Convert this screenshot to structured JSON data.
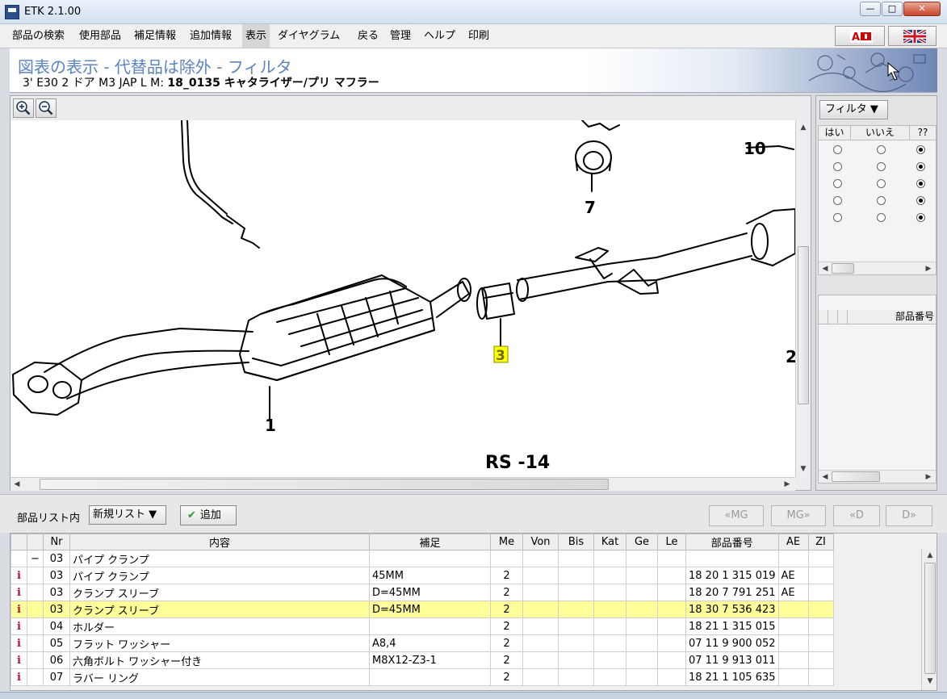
{
  "window": {
    "title": "ETK 2.1.00",
    "min": "—",
    "max": "□",
    "close": "✕"
  },
  "menu": {
    "items": [
      "部品の検索",
      "使用部品",
      "補足情報",
      "追加情報",
      "表示",
      "ダイヤグラム",
      "戻る",
      "管理",
      "ヘルプ",
      "印刷"
    ],
    "active_index": 4
  },
  "header": {
    "title": "図表の表示 - 代替品は除外 - フィルタ",
    "subtitle_model": "3' E30 2 ドア M3 JAP  L M: ",
    "subtitle_part": "18_0135 キャタライザー/プリ マフラー"
  },
  "diagram": {
    "labels": {
      "l1": "1",
      "l2": "2",
      "l3": "3",
      "l7": "7",
      "l10": "10",
      "ref": "RS -14"
    },
    "highlight_color": "#ffff00"
  },
  "filter": {
    "button": "フィルタ ▼",
    "columns": [
      "はい",
      "いいえ",
      "??"
    ],
    "rows": 5,
    "parts_header": "部品番号"
  },
  "list_toolbar": {
    "label": "部品リスト内",
    "list_select": "新規リスト ▼",
    "add": "追加",
    "nav": [
      "«MG",
      "MG»",
      "«D",
      "D»"
    ]
  },
  "table": {
    "columns": [
      "",
      "",
      "Nr",
      "内容",
      "補足",
      "Me",
      "Von",
      "Bis",
      "Kat",
      "Ge",
      "Le",
      "部品番号",
      "AE",
      "ZI"
    ],
    "rows": [
      {
        "i": "",
        "t": "−",
        "nr": "03",
        "desc": "パイプ クランプ",
        "sup": "",
        "me": "",
        "pn": "",
        "ae": "",
        "sel": false
      },
      {
        "i": "i",
        "t": "",
        "nr": "03",
        "desc": "パイプ クランプ",
        "sup": "45MM",
        "me": "2",
        "pn": "18 20 1 315 019",
        "ae": "AE",
        "sel": false
      },
      {
        "i": "i",
        "t": "",
        "nr": "03",
        "desc": "クランプ スリーブ",
        "sup": "D=45MM",
        "me": "2",
        "pn": "18 20 7 791 251",
        "ae": "AE",
        "sel": false
      },
      {
        "i": "i",
        "t": "",
        "nr": "03",
        "desc": "クランプ スリーブ",
        "sup": "D=45MM",
        "me": "2",
        "pn": "18 30 7 536 423",
        "ae": "",
        "sel": true
      },
      {
        "i": "i",
        "t": "",
        "nr": "04",
        "desc": "ホルダー",
        "sup": "",
        "me": "2",
        "pn": "18 21 1 315 015",
        "ae": "",
        "sel": false
      },
      {
        "i": "i",
        "t": "",
        "nr": "05",
        "desc": "フラット ワッシャー",
        "sup": "A8,4",
        "me": "2",
        "pn": "07 11 9 900 052",
        "ae": "",
        "sel": false
      },
      {
        "i": "i",
        "t": "",
        "nr": "06",
        "desc": "六角ボルト ワッシャー付き",
        "sup": "M8X12-Z3-1",
        "me": "2",
        "pn": "07 11 9 913 011",
        "ae": "",
        "sel": false
      },
      {
        "i": "i",
        "t": "",
        "nr": "07",
        "desc": "ラバー リング",
        "sup": "",
        "me": "2",
        "pn": "18 21 1 105 635",
        "ae": "",
        "sel": false
      }
    ]
  },
  "colors": {
    "accent": "#5b84c0",
    "selected_row": "#ffff99",
    "info_icon": "#b2103a"
  }
}
